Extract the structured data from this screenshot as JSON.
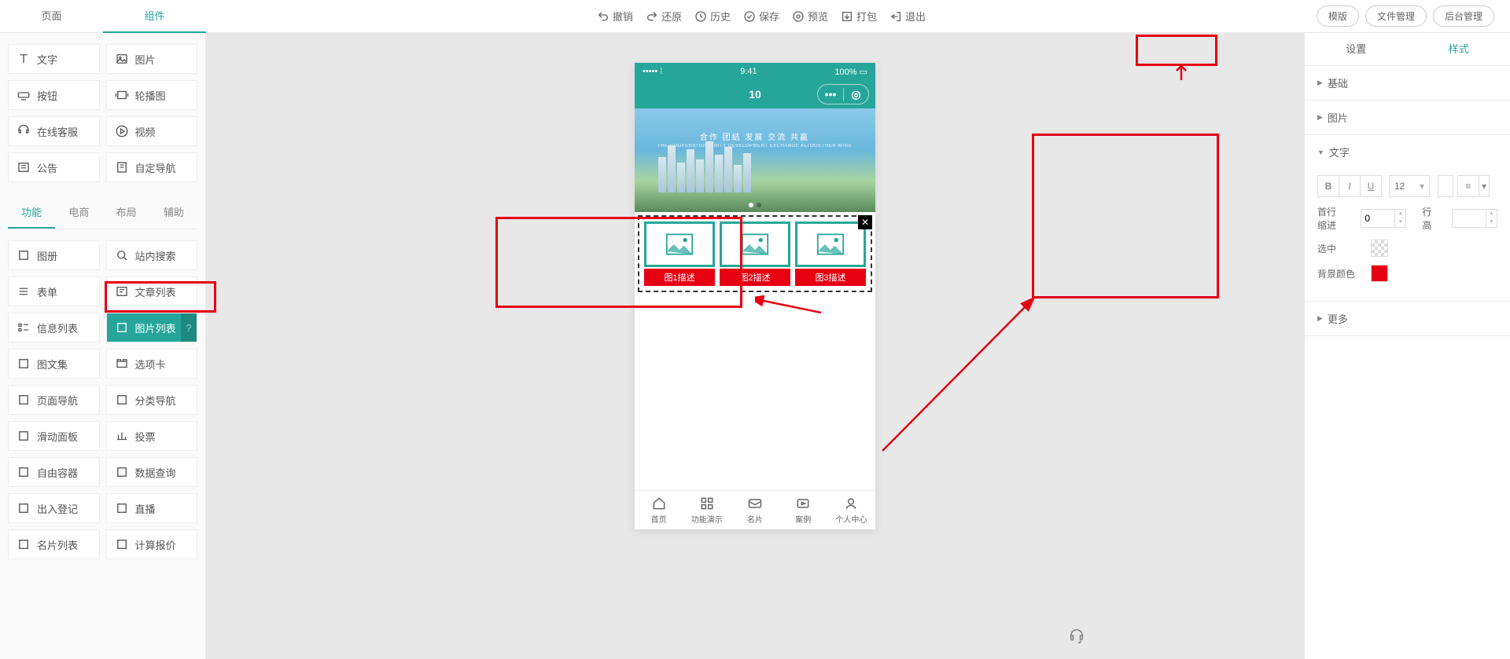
{
  "topTabs": {
    "page": "页面",
    "component": "组件"
  },
  "topActions": {
    "undo": "撤销",
    "redo": "还原",
    "history": "历史",
    "save": "保存",
    "preview": "预览",
    "pack": "打包",
    "exit": "退出"
  },
  "topButtons": {
    "template": "模版",
    "fileManage": "文件管理",
    "backend": "后台管理"
  },
  "basicComponents": [
    {
      "key": "text",
      "label": "文字"
    },
    {
      "key": "image",
      "label": "图片"
    },
    {
      "key": "button",
      "label": "按钮"
    },
    {
      "key": "carousel",
      "label": "轮播图"
    },
    {
      "key": "chat",
      "label": "在线客服"
    },
    {
      "key": "video",
      "label": "视频"
    },
    {
      "key": "notice",
      "label": "公告"
    },
    {
      "key": "customnav",
      "label": "自定导航"
    }
  ],
  "subTabs": {
    "func": "功能",
    "shop": "电商",
    "layout": "布局",
    "assist": "辅助"
  },
  "funcComponents": [
    {
      "key": "album",
      "label": "图册"
    },
    {
      "key": "search",
      "label": "站内搜索"
    },
    {
      "key": "form",
      "label": "表单"
    },
    {
      "key": "articlelist",
      "label": "文章列表"
    },
    {
      "key": "infolist",
      "label": "信息列表"
    },
    {
      "key": "imagelist",
      "label": "图片列表",
      "active": true
    },
    {
      "key": "gallery",
      "label": "图文集"
    },
    {
      "key": "tabs",
      "label": "选项卡"
    },
    {
      "key": "pagenav",
      "label": "页面导航"
    },
    {
      "key": "catnav",
      "label": "分类导航"
    },
    {
      "key": "slidepanel",
      "label": "滑动面板"
    },
    {
      "key": "vote",
      "label": "投票"
    },
    {
      "key": "freecontainer",
      "label": "自由容器"
    },
    {
      "key": "dataquery",
      "label": "数据查询"
    },
    {
      "key": "checkin",
      "label": "出入登记"
    },
    {
      "key": "live",
      "label": "直播"
    },
    {
      "key": "cardlist",
      "label": "名片列表"
    },
    {
      "key": "pricing",
      "label": "计算报价"
    }
  ],
  "phone": {
    "time": "9:41",
    "battery": "100%",
    "title": "10",
    "bannerText": "合作  团结  发展  交流  共赢",
    "bannerSub": "THE COOPERATION UNITY DEVELOPMENT EXCHANGE ALTOGETHER WINS",
    "imgLabels": [
      "图1描述",
      "图2描述",
      "图3描述"
    ],
    "tabs": [
      {
        "key": "home",
        "label": "首页"
      },
      {
        "key": "demo",
        "label": "功能演示"
      },
      {
        "key": "card",
        "label": "名片"
      },
      {
        "key": "case",
        "label": "案例"
      },
      {
        "key": "user",
        "label": "个人中心"
      }
    ]
  },
  "rightTabs": {
    "settings": "设置",
    "style": "样式"
  },
  "rightSections": {
    "basic": "基础",
    "image": "图片",
    "text": "文字",
    "more": "更多"
  },
  "textPanel": {
    "fontSize": "12",
    "indent": "首行缩进",
    "indentVal": "0",
    "lineHeight": "行高",
    "lineHeightVal": "",
    "selected": "选中",
    "bgColor": "背景颜色"
  }
}
